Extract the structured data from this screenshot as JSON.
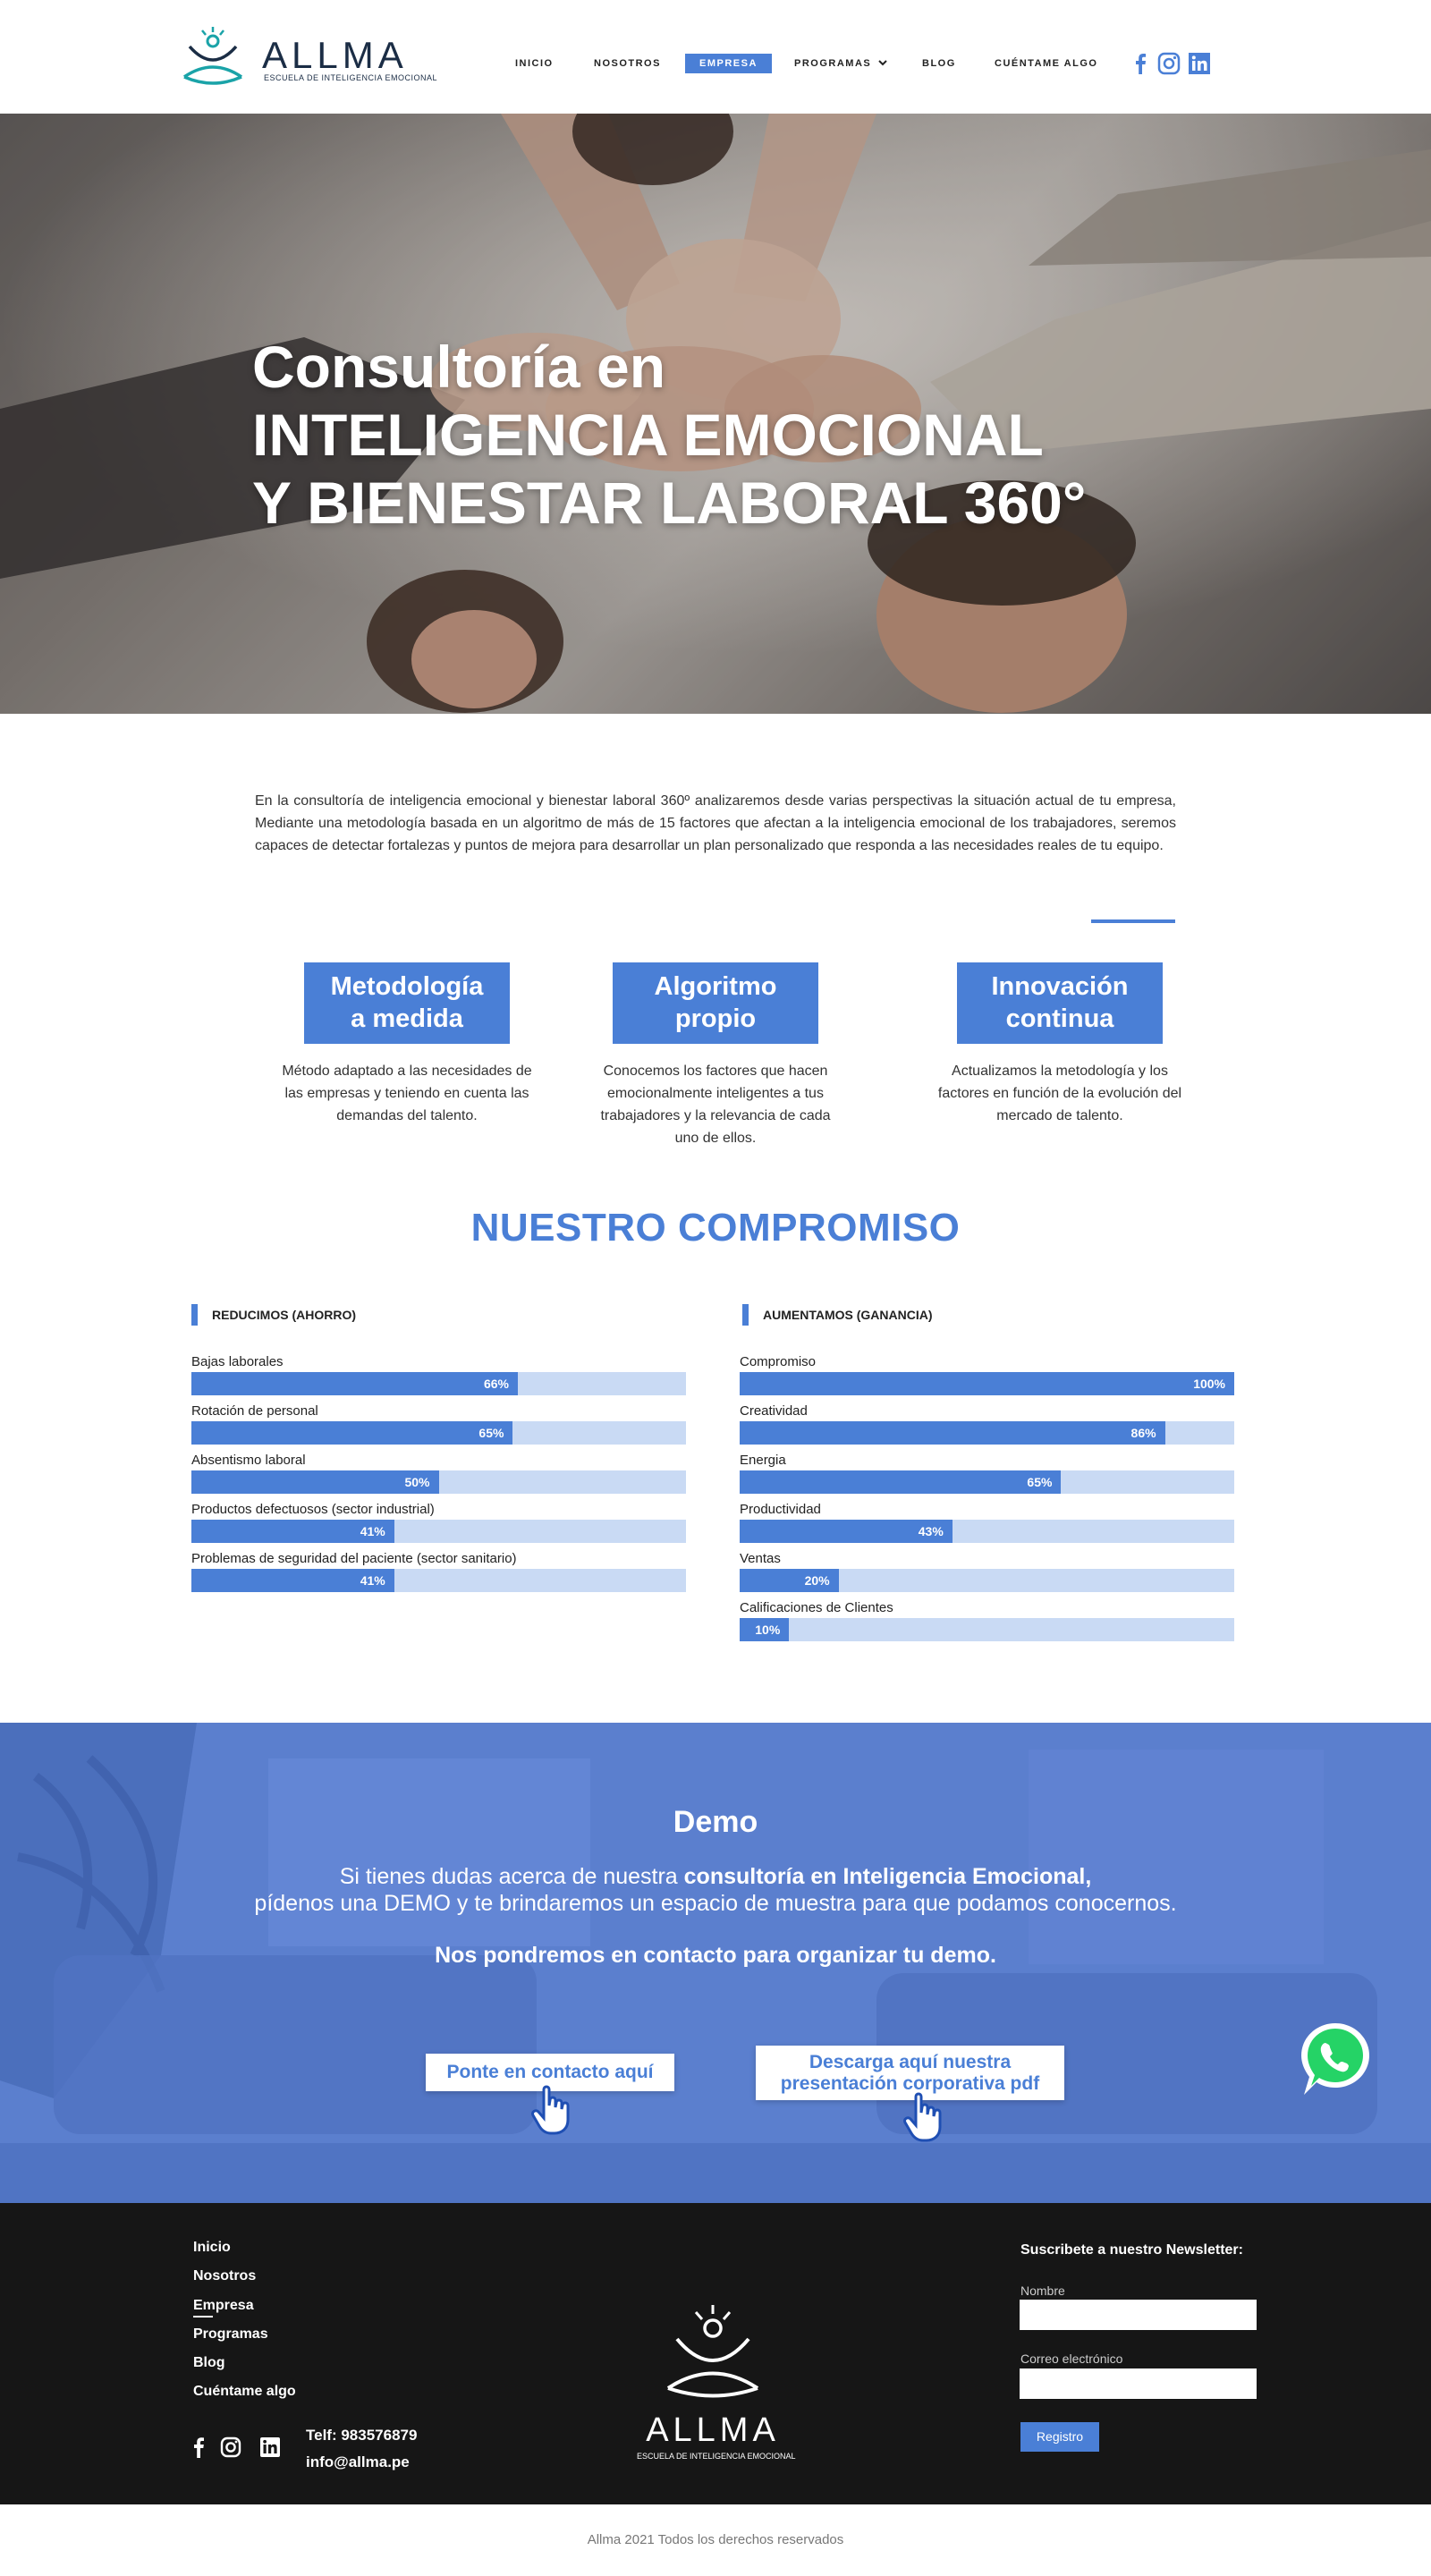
{
  "brand": {
    "name": "ALLMA",
    "tagline": "ESCUELA DE INTELIGENCIA EMOCIONAL"
  },
  "nav": {
    "items": [
      "INICIO",
      "NOSOTROS",
      "EMPRESA",
      "PROGRAMAS",
      "BLOG",
      "CUÉNTAME ALGO"
    ],
    "active": "EMPRESA",
    "dropdown_icon": "chevron-down-icon"
  },
  "social_icons": [
    "facebook-icon",
    "instagram-icon",
    "linkedin-icon"
  ],
  "hero": {
    "line1": "Consultoría en",
    "line2": "INTELIGENCIA EMOCIONAL",
    "line3": "Y BIENESTAR LABORAL 360°"
  },
  "intro": {
    "text": "En la consultoría de inteligencia emocional  y bienestar laboral 360º analizaremos desde varias perspectivas la situación actual de tu empresa, Mediante una metodología basada en un algoritmo de más de 15 factores que afectan a la inteligencia emocional de los trabajadores, seremos capaces de detectar fortalezas y puntos de mejora para desarrollar un plan personalizado que responda a las necesidades reales de tu equipo."
  },
  "features": [
    {
      "title1": "Metodología",
      "title2": "a medida",
      "text": "Método adaptado a las necesidades de las empresas y teniendo en cuenta las demandas del talento."
    },
    {
      "title1": "Algoritmo",
      "title2": "propio",
      "text": "Conocemos los factores que hacen emocionalmente inteligentes a tus trabajadores y la relevancia de cada uno de ellos."
    },
    {
      "title1": "Innovación",
      "title2": "continua",
      "text": "Actualizamos la metodología y los factores en función de la evolución del mercado de talento."
    }
  ],
  "commitment": {
    "title": "NUESTRO COMPROMISO",
    "left_heading": "REDUCIMOS (AHORRO)",
    "right_heading": "AUMENTAMOS (GANANCIA)",
    "left": [
      {
        "label": "Bajas laborales",
        "value": 66,
        "text": "66%"
      },
      {
        "label": "Rotación de personal",
        "value": 65,
        "text": "65%"
      },
      {
        "label": "Absentismo laboral",
        "value": 50,
        "text": "50%"
      },
      {
        "label": "Productos defectuosos (sector industrial)",
        "value": 41,
        "text": "41%"
      },
      {
        "label": "Problemas de seguridad del paciente (sector sanitario)",
        "value": 41,
        "text": "41%"
      }
    ],
    "right": [
      {
        "label": "Compromiso",
        "value": 100,
        "text": "100%"
      },
      {
        "label": "Creatividad",
        "value": 86,
        "text": "86%"
      },
      {
        "label": "Energia",
        "value": 65,
        "text": "65%"
      },
      {
        "label": "Productividad",
        "value": 43,
        "text": "43%"
      },
      {
        "label": "Ventas",
        "value": 20,
        "text": "20%"
      },
      {
        "label": "Calificaciones de Clientes",
        "value": 10,
        "text": "10%"
      }
    ]
  },
  "demo": {
    "title": "Demo",
    "line1_pre": "Si tienes dudas acerca de nuestra ",
    "line1_bold": "consultoría en Inteligencia Emocional,",
    "line2": "pídenos una DEMO y te brindaremos un espacio de muestra para que podamos conocernos.",
    "line3": "Nos pondremos en contacto para organizar tu demo.",
    "button1": "Ponte en contacto aquí",
    "button2_line1": "Descarga aquí nuestra",
    "button2_line2": "presentación corporativa pdf"
  },
  "footer": {
    "links": [
      "Inicio",
      "Nosotros",
      "Empresa",
      "Programas",
      "Blog",
      "Cuéntame algo"
    ],
    "phone": "Telf: 983576879",
    "email": "info@allma.pe",
    "logo_name": "ALLMA",
    "logo_tagline": "ESCUELA DE INTELIGENCIA EMOCIONAL",
    "newsletter_title": "Suscribete a nuestro Newsletter:",
    "name_label": "Nombre",
    "email_label": "Correo electrónico",
    "register_button": "Registro"
  },
  "copyright": "Allma 2021 Todos los derechos reservados",
  "colors": {
    "accent": "#4a7fd6",
    "bar_track": "#c9daf4",
    "footer_bg": "#161616",
    "demo_bg": "#5a7fcf",
    "logo_teal": "#1aa3a8"
  }
}
